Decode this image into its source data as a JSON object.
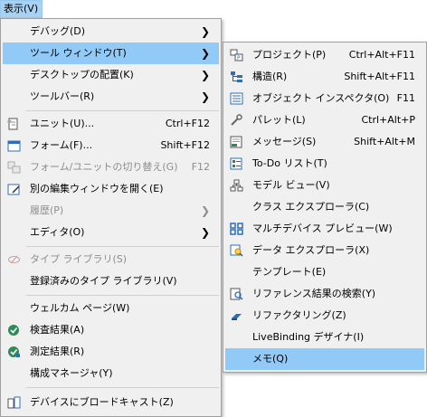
{
  "menubar": {
    "view": "表示(V)"
  },
  "main_menu": {
    "items": [
      {
        "label": "デバッグ(D)",
        "submenu": true,
        "disabled": false,
        "icon": null
      },
      {
        "label": "ツール ウィンドウ(T)",
        "submenu": true,
        "highlighted": true,
        "disabled": false,
        "icon": null
      },
      {
        "label": "デスクトップの配置(K)",
        "submenu": true,
        "disabled": false,
        "icon": null
      },
      {
        "label": "ツールバー(R)",
        "submenu": true,
        "disabled": false,
        "icon": null
      },
      {
        "label": "ユニット(U)...",
        "shortcut": "Ctrl+F12",
        "disabled": false,
        "icon": "unit-icon"
      },
      {
        "label": "フォーム(F)...",
        "shortcut": "Shift+F12",
        "disabled": false,
        "icon": "form-icon"
      },
      {
        "label": "フォーム/ユニットの切り替え(G)",
        "shortcut": "F12",
        "disabled": true,
        "icon": "toggle-form-unit-icon"
      },
      {
        "label": "別の編集ウィンドウを開く(E)",
        "disabled": false,
        "icon": "new-edit-window-icon"
      },
      {
        "label": "履歴(P)",
        "submenu": true,
        "disabled": true,
        "icon": null
      },
      {
        "label": "エディタ(O)",
        "submenu": true,
        "disabled": false,
        "icon": null
      },
      {
        "label": "タイプ ライブラリ(S)",
        "disabled": true,
        "icon": "type-library-icon"
      },
      {
        "label": "登録済みのタイプ ライブラリ(V)",
        "disabled": false,
        "icon": null
      },
      {
        "label": "ウェルカム ページ(W)",
        "disabled": false,
        "icon": null
      },
      {
        "label": "検査結果(A)",
        "disabled": false,
        "icon": "audit-results-icon"
      },
      {
        "label": "測定結果(R)",
        "disabled": false,
        "icon": "metrics-results-icon"
      },
      {
        "label": "構成マネージャ(Y)",
        "disabled": false,
        "icon": null
      },
      {
        "label": "デバイスにブロードキャスト(Z)",
        "disabled": false,
        "icon": "broadcast-icon"
      }
    ]
  },
  "tool_windows_menu": {
    "items": [
      {
        "label": "プロジェクト(P)",
        "shortcut": "Ctrl+Alt+F11",
        "icon": "project-icon"
      },
      {
        "label": "構造(R)",
        "shortcut": "Shift+Alt+F11",
        "icon": "structure-icon"
      },
      {
        "label": "オブジェクト インスペクタ(O)",
        "shortcut": "F11",
        "icon": "object-inspector-icon"
      },
      {
        "label": "パレット(L)",
        "shortcut": "Ctrl+Alt+P",
        "icon": "palette-wrench-icon"
      },
      {
        "label": "メッセージ(S)",
        "shortcut": "Shift+Alt+M",
        "icon": "messages-icon"
      },
      {
        "label": "To-Do リスト(T)",
        "icon": "todo-list-icon"
      },
      {
        "label": "モデル ビュー(V)",
        "icon": "model-view-icon"
      },
      {
        "label": "クラス エクスプローラ(C)",
        "icon": null
      },
      {
        "label": "マルチデバイス プレビュー(W)",
        "icon": "multi-device-preview-icon"
      },
      {
        "label": "データ エクスプローラ(X)",
        "icon": "data-explorer-icon"
      },
      {
        "label": "テンプレート(E)",
        "icon": null
      },
      {
        "label": "リファレンス結果の検索(Y)",
        "icon": "find-references-icon"
      },
      {
        "label": "リファクタリング(Z)",
        "icon": "refactoring-icon"
      },
      {
        "label": "LiveBinding デザイナ(I)",
        "icon": null
      },
      {
        "label": "メモ(Q)",
        "highlighted": true,
        "icon": null
      }
    ]
  },
  "colors": {
    "menu_bg": "#f0f0f0",
    "highlight": "#91c9f7",
    "disabled_text": "#8d8d8d",
    "separator": "#d0d0d0",
    "icon_blue": "#2c6fb7"
  }
}
